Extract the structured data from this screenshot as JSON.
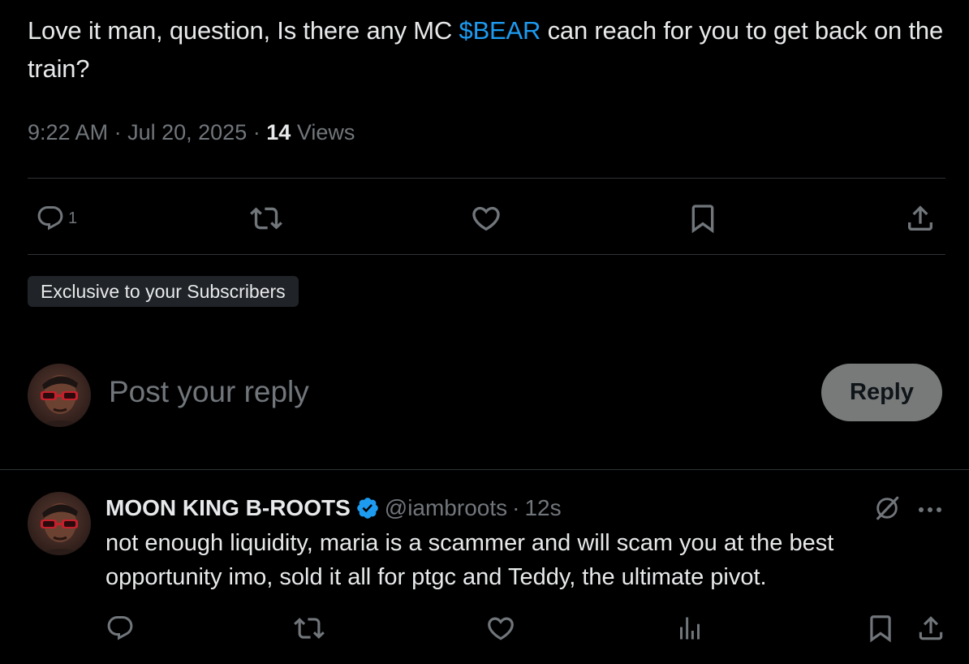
{
  "post": {
    "text_before": "Love it man, question, Is there any MC ",
    "cashtag": "$BEAR",
    "text_after": " can reach for you to get back on the train?",
    "time": "9:22 AM",
    "sep1": "·",
    "date": "Jul 20, 2025",
    "sep2": "·",
    "views_count": "14",
    "views_label": "Views",
    "actions": {
      "reply_icon": "reply-bubble-icon",
      "reply_count": "1",
      "repost_icon": "repost-icon",
      "like_icon": "heart-icon",
      "bookmark_icon": "bookmark-icon",
      "share_icon": "share-icon"
    }
  },
  "badge": {
    "label": "Exclusive to your Subscribers"
  },
  "composer": {
    "placeholder": "Post your reply",
    "button_label": "Reply"
  },
  "reply": {
    "name": "MOON KING B-ROOTS",
    "handle": "@iambroots",
    "dot": "·",
    "time": "12s",
    "text": "not enough liquidity, maria is a scammer and will scam you at the best opportunity imo, sold it all for ptgc and Teddy, the ultimate pivot.",
    "icons": {
      "grok": "grok-icon",
      "more": "more-icon",
      "reply": "reply-bubble-icon",
      "repost": "repost-icon",
      "like": "heart-icon",
      "analytics": "analytics-icon",
      "bookmark": "bookmark-icon",
      "share": "share-icon"
    }
  },
  "colors": {
    "background": "#000000",
    "text": "#e7e9ea",
    "muted": "#71767b",
    "link": "#1d9bf0",
    "divider": "#2f3336",
    "reply_button": "#787a7a",
    "badge_bg": "#202327",
    "verified": "#1d9bf0"
  }
}
